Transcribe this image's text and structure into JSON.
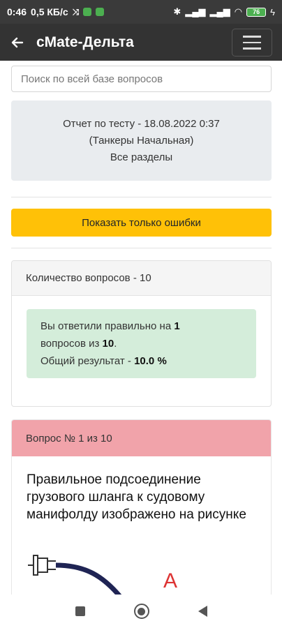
{
  "status_bar": {
    "time": "0:46",
    "network_speed": "0,5 КБ/с",
    "battery": "76",
    "icons": [
      "data-saver-icon",
      "app-notification-icon",
      "app-notification-icon",
      "bluetooth-icon",
      "signal-icon",
      "signal-icon",
      "wifi-icon",
      "battery-icon",
      "charging-icon"
    ]
  },
  "app_bar": {
    "back_icon": "arrow-left-icon",
    "title": "cMate-Дельта",
    "menu_icon": "hamburger-menu-icon"
  },
  "search": {
    "placeholder": "Поиск по всей базе вопросов",
    "value": ""
  },
  "report": {
    "line1": "Отчет по тесту - 18.08.2022 0:37",
    "line2": "(Танкеры Начальная)",
    "line3": "Все разделы"
  },
  "errors_button": {
    "label": "Показать только ошибки",
    "color": "#ffc107"
  },
  "summary": {
    "header": "Количество вопросов - 10",
    "text_prefix": "Вы ответили правильно на ",
    "correct": "1",
    "text_mid": " вопросов из ",
    "total": "10",
    "text_end": ".",
    "result_prefix": "Общий результат - ",
    "result_value": "10.0 %",
    "color": "#d4edda"
  },
  "question": {
    "header": "Вопрос № 1 из 10",
    "text": "Правильное подсоединение грузового шланга к судовому манифолду изображено на рисунке",
    "image_label": "A",
    "header_color": "#f1a3aa"
  },
  "nav_bar": {
    "icons": [
      "recents-square-icon",
      "home-circle-icon",
      "back-triangle-icon"
    ]
  }
}
